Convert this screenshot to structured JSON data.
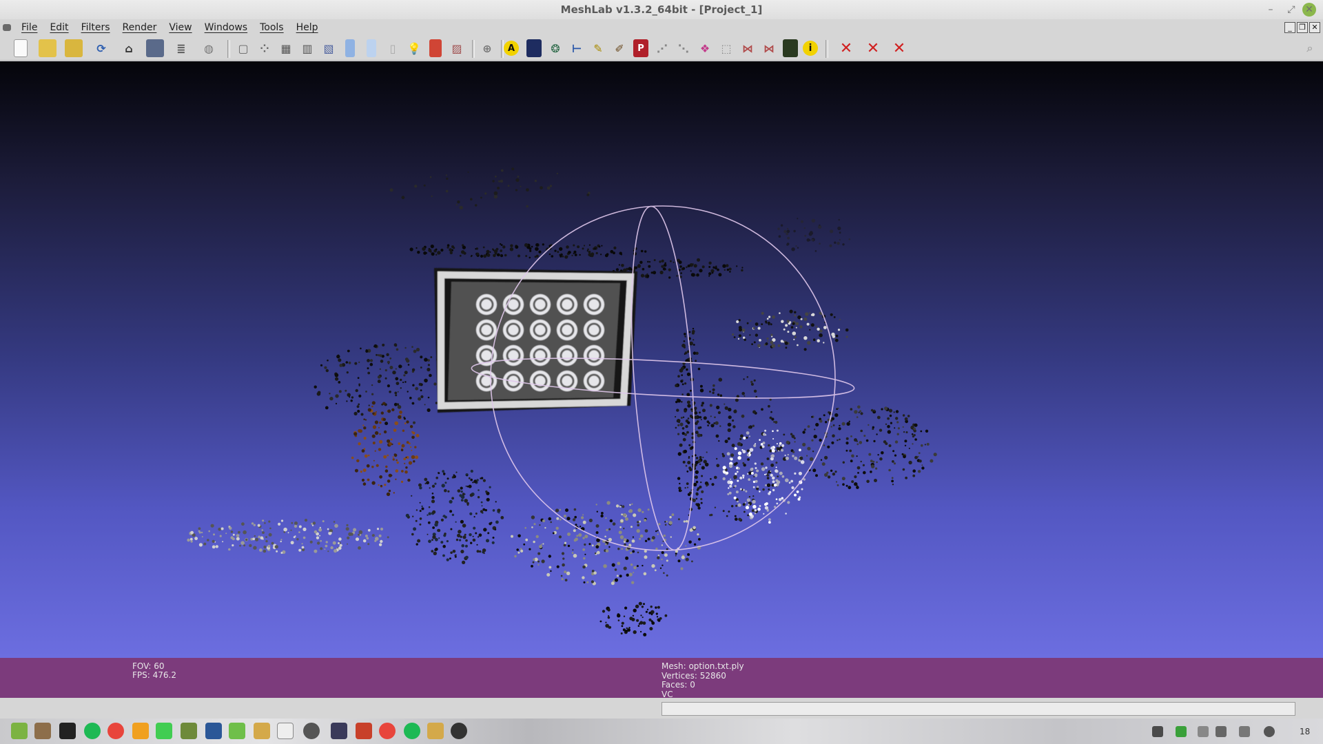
{
  "window": {
    "title": "MeshLab v1.3.2_64bit - [Project_1]"
  },
  "menubar": {
    "items": [
      "File",
      "Edit",
      "Filters",
      "Render",
      "View",
      "Windows",
      "Tools",
      "Help"
    ]
  },
  "toolbar": {
    "file_tools": [
      "new-icon",
      "open-icon",
      "open-project-icon",
      "reload-icon",
      "save-icon",
      "snapshot-icon",
      "layers-icon",
      "sphere-icon"
    ],
    "render_tools": [
      "bbox-icon",
      "points-icon",
      "wireframe-icon",
      "hidden-lines-icon",
      "flat-icon",
      "flat-lines-icon",
      "smooth-icon",
      "light-icon",
      "fancy-light-icon",
      "back-face-icon"
    ],
    "edit_tools": [
      "manipulator-icon",
      "annotation-icon",
      "texture-icon",
      "mesh-info-icon",
      "measure-icon",
      "pick-points-icon",
      "paint-icon",
      "paint-p-icon",
      "select-faces-icon",
      "select-vertices-icon",
      "select-connected-icon",
      "select-region-icon",
      "delete-faces-icon",
      "delete-vertices-icon",
      "z-painting-icon",
      "info-icon"
    ],
    "delete_tools": [
      "delete-selected-faces-icon",
      "delete-selected-vertices-icon",
      "delete-selection-icon"
    ]
  },
  "viewport": {
    "info": {
      "fov": "FOV: 60",
      "fps": "FPS:   476.2",
      "mesh": "Mesh: option.txt.ply",
      "vertices": "Vertices: 52860",
      "faces": "Faces: 0",
      "vc": "VC"
    }
  },
  "taskbar": {
    "apps": [
      "mint-menu-icon",
      "files-icon",
      "terminal-icon",
      "spotify-icon",
      "chrome-icon",
      "fox-icon",
      "qt-icon",
      "gear-icon",
      "code-icon",
      "calc-icon",
      "folder-icon",
      "screenshot-icon",
      "shell-icon",
      "writer-icon",
      "image-viewer-icon",
      "chrome-app-icon",
      "spotify-app-icon",
      "file-manager-icon",
      "refresh-app-icon"
    ],
    "tray": [
      "dropbox-icon",
      "shield-icon",
      "network-icon",
      "notifications-icon",
      "volume-icon",
      "help-icon"
    ],
    "clock": "18"
  },
  "colors": {
    "viewport_top": "#05050a",
    "viewport_bottom": "#6c6ee0",
    "info_bg": "#7c3b7c",
    "trackball": "#e0c8ec"
  }
}
